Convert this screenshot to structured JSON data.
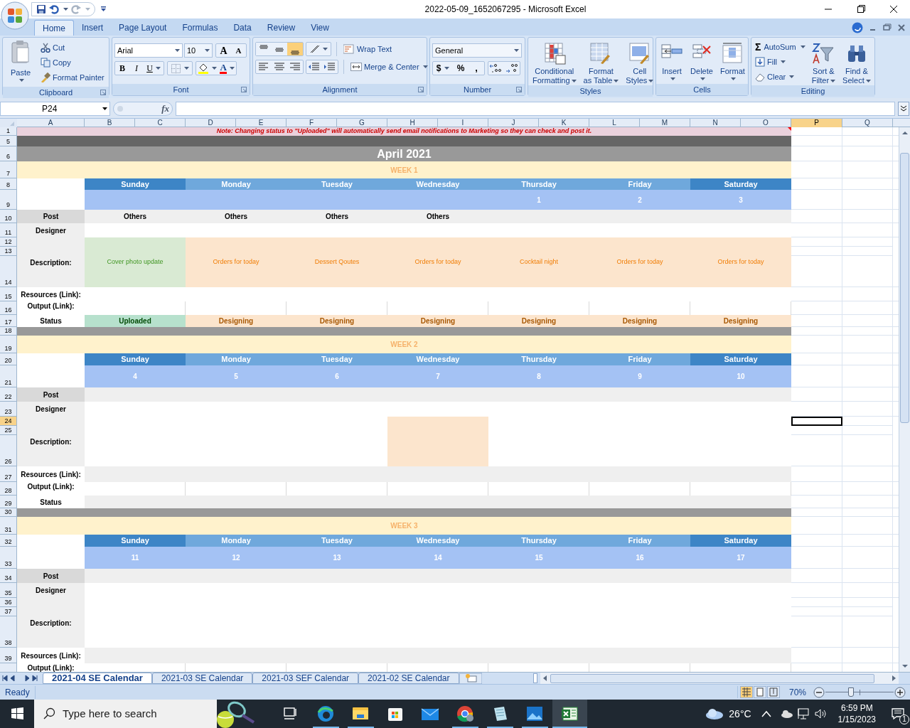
{
  "window": {
    "title": "2022-05-09_1652067295 - Microsoft Excel"
  },
  "ribbon_tabs": [
    {
      "label": "Home",
      "selected": true
    },
    {
      "label": "Insert",
      "selected": false
    },
    {
      "label": "Page Layout",
      "selected": false
    },
    {
      "label": "Formulas",
      "selected": false
    },
    {
      "label": "Data",
      "selected": false
    },
    {
      "label": "Review",
      "selected": false
    },
    {
      "label": "View",
      "selected": false
    }
  ],
  "ribbon": {
    "clipboard": {
      "paste": "Paste",
      "cut": "Cut",
      "copy": "Copy",
      "format_painter": "Format Painter",
      "label": "Clipboard"
    },
    "font": {
      "name": "Arial",
      "size": "10",
      "grow": "A",
      "shrink": "A",
      "bold": "B",
      "italic": "I",
      "underline": "U",
      "font_color": "A",
      "label": "Font"
    },
    "alignment": {
      "vertical": [
        {
          "selected": false
        },
        {
          "selected": false
        },
        {
          "selected": true
        }
      ],
      "wrap_text": "Wrap Text",
      "merge_center": "Merge & Center",
      "label": "Alignment"
    },
    "number": {
      "format": "General",
      "currency": "$",
      "percent": "%",
      "comma": ",",
      "label": "Number"
    },
    "styles": {
      "buttons": [
        [
          "Conditional",
          "Formatting"
        ],
        [
          "Format",
          "as Table"
        ],
        [
          "Cell",
          "Styles"
        ]
      ],
      "label": "Styles"
    },
    "cells": {
      "buttons": [
        "Insert",
        "Delete",
        "Format"
      ],
      "label": "Cells"
    },
    "editing": {
      "autosum_symbol": "Σ",
      "autosum": "AutoSum",
      "fill": "Fill",
      "clear": "Clear",
      "sort_filter": [
        "Sort &",
        "Filter"
      ],
      "find_select": [
        "Find &",
        "Select"
      ],
      "label": "Editing"
    }
  },
  "formula_bar": {
    "name_box": "P24",
    "fx": "fx"
  },
  "sheet": {
    "columns": [
      {
        "label": "A",
        "selected": false
      },
      {
        "label": "B",
        "selected": false
      },
      {
        "label": "C",
        "selected": false
      },
      {
        "label": "D",
        "selected": false
      },
      {
        "label": "E",
        "selected": false
      },
      {
        "label": "F",
        "selected": false
      },
      {
        "label": "G",
        "selected": false
      },
      {
        "label": "H",
        "selected": false
      },
      {
        "label": "I",
        "selected": false
      },
      {
        "label": "J",
        "selected": false
      },
      {
        "label": "K",
        "selected": false
      },
      {
        "label": "L",
        "selected": false
      },
      {
        "label": "M",
        "selected": false
      },
      {
        "label": "N",
        "selected": false
      },
      {
        "label": "O",
        "selected": false
      },
      {
        "label": "P",
        "selected": true
      },
      {
        "label": "Q",
        "selected": false
      }
    ],
    "note": {
      "row": "1",
      "text": "Note: Changing status to \"Uploaded\" will automatically send email notifications to Marketing so they can check and post it."
    },
    "banner_row": "5",
    "month": {
      "row": "6",
      "text": "April 2021"
    },
    "weeks": [
      {
        "label": "WEEK 1",
        "row_numbers": [
          {
            "label": "7",
            "selected": false
          },
          {
            "label": "8",
            "selected": false
          },
          {
            "label": "9",
            "selected": false
          },
          {
            "label": "10",
            "selected": false
          },
          {
            "label": "11",
            "selected": false
          },
          {
            "label": "12",
            "selected": false
          },
          {
            "label": "13",
            "selected": false
          },
          {
            "label": "14",
            "selected": false
          },
          {
            "label": "15",
            "selected": false
          },
          {
            "label": "16",
            "selected": false
          },
          {
            "label": "17",
            "selected": false
          },
          {
            "label": "18",
            "selected": false
          }
        ],
        "row_labels": [
          "Post",
          "Designer",
          "Description:",
          "Resources (Link):",
          "Output (Link):",
          "Status"
        ],
        "days": [
          {
            "name": "Sunday",
            "color": "#3d85c6",
            "post": "Others",
            "description": {
              "text": "Cover photo update",
              "color": "#d9ead3"
            },
            "status": {
              "text": "Uploaded",
              "color": "#b7e1cd"
            }
          },
          {
            "name": "Monday",
            "color": "#6fa8dc",
            "post": "Others",
            "description": {
              "text": "Orders for today",
              "color": "#fce5cd"
            },
            "status": {
              "text": "Designing",
              "color": "#fce5cd"
            }
          },
          {
            "name": "Tuesday",
            "color": "#6fa8dc",
            "post": "Others",
            "description": {
              "text": "Dessert Qoutes",
              "color": "#fce5cd"
            },
            "status": {
              "text": "Designing",
              "color": "#fce5cd"
            }
          },
          {
            "name": "Wednesday",
            "color": "#6fa8dc",
            "post": "Others",
            "description": {
              "text": "Orders for today",
              "color": "#fce5cd"
            },
            "status": {
              "text": "Designing",
              "color": "#fce5cd"
            }
          },
          {
            "name": "Thursday",
            "color": "#6fa8dc",
            "date": "1",
            "description": {
              "text": "Cocktail night",
              "color": "#fce5cd"
            },
            "status": {
              "text": "Designing",
              "color": "#fce5cd"
            }
          },
          {
            "name": "Friday",
            "color": "#6fa8dc",
            "date": "2",
            "description": {
              "text": "Orders for today",
              "color": "#fce5cd"
            },
            "status": {
              "text": "Designing",
              "color": "#fce5cd"
            }
          },
          {
            "name": "Saturday",
            "color": "#3d85c6",
            "date": "3",
            "description": {
              "text": "Orders for today",
              "color": "#fce5cd"
            },
            "status": {
              "text": "Designing",
              "color": "#fce5cd"
            }
          }
        ]
      },
      {
        "label": "WEEK 2",
        "row_numbers": [
          {
            "label": "19",
            "selected": false
          },
          {
            "label": "20",
            "selected": false
          },
          {
            "label": "21",
            "selected": false
          },
          {
            "label": "22",
            "selected": false
          },
          {
            "label": "23",
            "selected": false
          },
          {
            "label": "24",
            "selected": true
          },
          {
            "label": "25",
            "selected": false
          },
          {
            "label": "26",
            "selected": false
          },
          {
            "label": "27",
            "selected": false
          },
          {
            "label": "28",
            "selected": false
          },
          {
            "label": "29",
            "selected": false
          },
          {
            "label": "30",
            "selected": false
          }
        ],
        "row_labels": [
          "Post",
          "Designer",
          "Description:",
          "Resources (Link):",
          "Output (Link):",
          "Status"
        ],
        "days": [
          {
            "name": "Sunday",
            "color": "#3d85c6",
            "date": "4"
          },
          {
            "name": "Monday",
            "color": "#6fa8dc",
            "date": "5"
          },
          {
            "name": "Tuesday",
            "color": "#6fa8dc",
            "date": "6"
          },
          {
            "name": "Wednesday",
            "color": "#6fa8dc",
            "date": "7",
            "description": {
              "color": "#fce5cd"
            }
          },
          {
            "name": "Thursday",
            "color": "#6fa8dc",
            "date": "8"
          },
          {
            "name": "Friday",
            "color": "#6fa8dc",
            "date": "9"
          },
          {
            "name": "Saturday",
            "color": "#3d85c6",
            "date": "10"
          }
        ]
      },
      {
        "label": "WEEK 3",
        "row_numbers": [
          {
            "label": "31",
            "selected": false
          },
          {
            "label": "32",
            "selected": false
          },
          {
            "label": "33",
            "selected": false
          },
          {
            "label": "34",
            "selected": false
          },
          {
            "label": "35",
            "selected": false
          },
          {
            "label": "36",
            "selected": false
          },
          {
            "label": "37",
            "selected": false
          },
          {
            "label": "38",
            "selected": false
          },
          {
            "label": "39",
            "selected": false
          }
        ],
        "row_labels": [
          "Post",
          "Designer",
          "Description:",
          "Resources (Link):",
          "Output (Link):"
        ],
        "days": [
          {
            "name": "Sunday",
            "color": "#3d85c6",
            "date": "11"
          },
          {
            "name": "Monday",
            "color": "#6fa8dc",
            "date": "12"
          },
          {
            "name": "Tuesday",
            "color": "#6fa8dc",
            "date": "13"
          },
          {
            "name": "Wednesday",
            "color": "#6fa8dc",
            "date": "14"
          },
          {
            "name": "Thursday",
            "color": "#6fa8dc",
            "date": "15"
          },
          {
            "name": "Friday",
            "color": "#6fa8dc",
            "date": "16"
          },
          {
            "name": "Saturday",
            "color": "#3d85c6",
            "date": "17"
          }
        ]
      }
    ]
  },
  "sheet_tabs": [
    {
      "label": "2021-04 SE Calendar",
      "selected": true
    },
    {
      "label": "2021-03 SE Calendar",
      "selected": false
    },
    {
      "label": "2021-03 SEF Calendar",
      "selected": false
    },
    {
      "label": "2021-02 SE Calendar",
      "selected": false
    }
  ],
  "status_bar": {
    "text": "Ready",
    "views": [
      {
        "selected": true
      },
      {
        "selected": false
      },
      {
        "selected": false
      }
    ],
    "zoom": "70%",
    "zoom_slider": {
      "level": 0.37
    }
  },
  "taskbar": {
    "search_placeholder": "Type here to search",
    "apps": [
      {
        "running": false,
        "selected": false
      },
      {
        "running": true,
        "selected": false
      },
      {
        "running": true,
        "selected": false
      },
      {
        "running": false,
        "selected": false
      },
      {
        "running": false,
        "selected": false
      },
      {
        "running": true,
        "selected": false
      },
      {
        "running": true,
        "selected": false
      },
      {
        "running": true,
        "selected": false
      },
      {
        "running": true,
        "selected": true
      }
    ],
    "weather": "26°C",
    "time": "6:59 PM",
    "date": "1/15/2023",
    "notifications": "1"
  }
}
